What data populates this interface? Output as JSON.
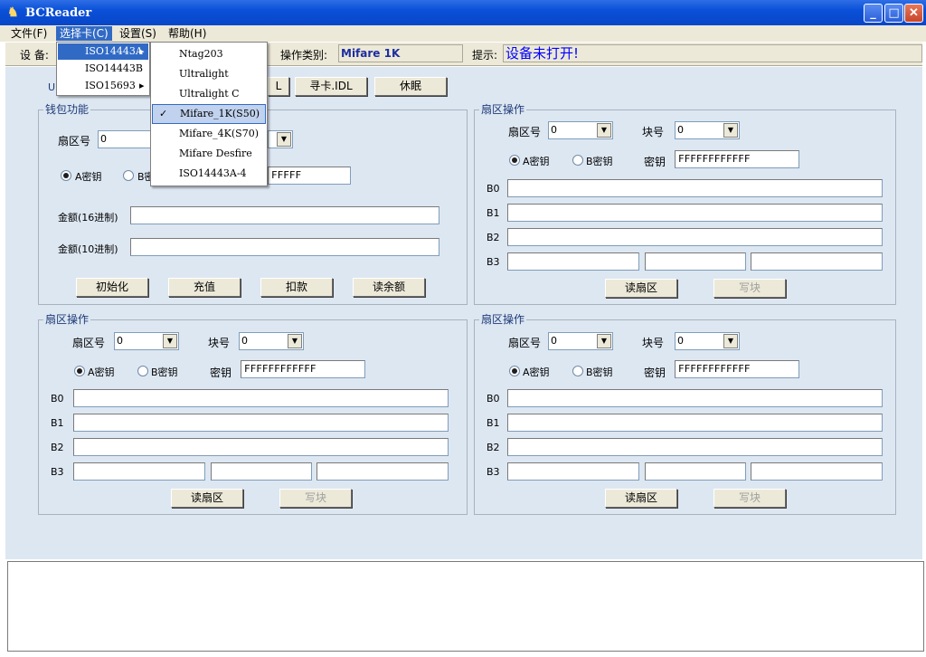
{
  "window": {
    "title": "BCReader"
  },
  "menubar": {
    "file": "文件(F)",
    "select_card": "选择卡(C)",
    "settings": "设置(S)",
    "help": "帮助(H)"
  },
  "status": {
    "device_label": "设 备:",
    "op_type_label": "操作类别:",
    "op_type_value": "Mifare 1K",
    "hint_label": "提示:",
    "hint_value": "设备未打开!"
  },
  "toolbar": {
    "uid_label": "UI",
    "btn_l": "L",
    "find_card": "寻卡.IDL",
    "sleep": "休眠"
  },
  "wallet": {
    "title": "钱包功能",
    "sector_label": "扇区号",
    "sector_value": "0",
    "key_a": "A密钥",
    "key_b": "B密",
    "key_value": "FFFFF",
    "amount_hex_label": "金额(16进制)",
    "amount_dec_label": "金额(10进制)",
    "init": "初始化",
    "recharge": "充值",
    "deduct": "扣款",
    "read_balance": "读余额"
  },
  "sectors": [
    {
      "title": "扇区操作",
      "sector_label": "扇区号",
      "sector_value": "0",
      "block_label": "块号",
      "block_value": "0",
      "key_a": "A密钥",
      "key_b": "B密钥",
      "key_label": "密钥",
      "key_value": "FFFFFFFFFFFF",
      "b0": "B0",
      "b1": "B1",
      "b2": "B2",
      "b3": "B3",
      "read": "读扇区",
      "write": "写块"
    },
    {
      "title": "扇区操作",
      "sector_label": "扇区号",
      "sector_value": "0",
      "block_label": "块号",
      "block_value": "0",
      "key_a": "A密钥",
      "key_b": "B密钥",
      "key_label": "密钥",
      "key_value": "FFFFFFFFFFFF",
      "b0": "B0",
      "b1": "B1",
      "b2": "B2",
      "b3": "B3",
      "read": "读扇区",
      "write": "写块"
    },
    {
      "title": "扇区操作",
      "sector_label": "扇区号",
      "sector_value": "0",
      "block_label": "块号",
      "block_value": "0",
      "key_a": "A密钥",
      "key_b": "B密钥",
      "key_label": "密钥",
      "key_value": "FFFFFFFFFFFF",
      "b0": "B0",
      "b1": "B1",
      "b2": "B2",
      "b3": "B3",
      "read": "读扇区",
      "write": "写块"
    }
  ],
  "menu_select": [
    "ISO14443A",
    "ISO14443B",
    "ISO15693"
  ],
  "submenu": [
    "Ntag203",
    "Ultralight",
    "Ultralight C",
    "Mifare_1K(S50)",
    "Mifare_4K(S70)",
    "Mifare Desfire",
    "ISO14443A-4"
  ],
  "colors": {
    "titlebar": "#0a50d8",
    "menu_highlight": "#316ac5",
    "panel": "#dde7f2",
    "hint_text": "#0000ff"
  }
}
